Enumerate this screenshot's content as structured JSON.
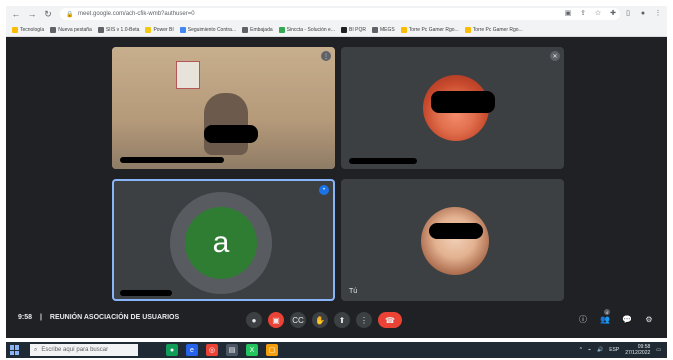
{
  "browser": {
    "url": "meet.google.com/ach-cfik-wmb?authuser=0",
    "bookmarks": [
      "Tecnología",
      "Nueva pestaña",
      "SIIS v 1.0-Beta",
      "Power BI",
      "Seguimiento Contra...",
      "Embajada",
      "Sinccta - Solución e...",
      "BI PQR",
      "MEGS",
      "Torre Pc Gamer Rgo...",
      "Torre Pc Gamer Rgo..."
    ]
  },
  "meeting": {
    "time": "9:58",
    "separator": "|",
    "title": "REUNIÓN ASOCIACIÓN DE USUARIOS",
    "participant_count_badge": "4",
    "tiles": [
      {
        "label": ""
      },
      {
        "label": ""
      },
      {
        "avatar_letter": "a",
        "label": ""
      },
      {
        "label": "Tú"
      }
    ],
    "colors": {
      "meet_bg": "#202124",
      "tile_bg": "#3c4043",
      "active_outline": "#8ab4f8",
      "hangup_red": "#ea4335",
      "avatar_green": "#2f7d32"
    }
  },
  "taskbar": {
    "search_placeholder": "Escribe aquí para buscar",
    "clock": "09:58",
    "date": "27/12/2022",
    "language": "ESP"
  }
}
